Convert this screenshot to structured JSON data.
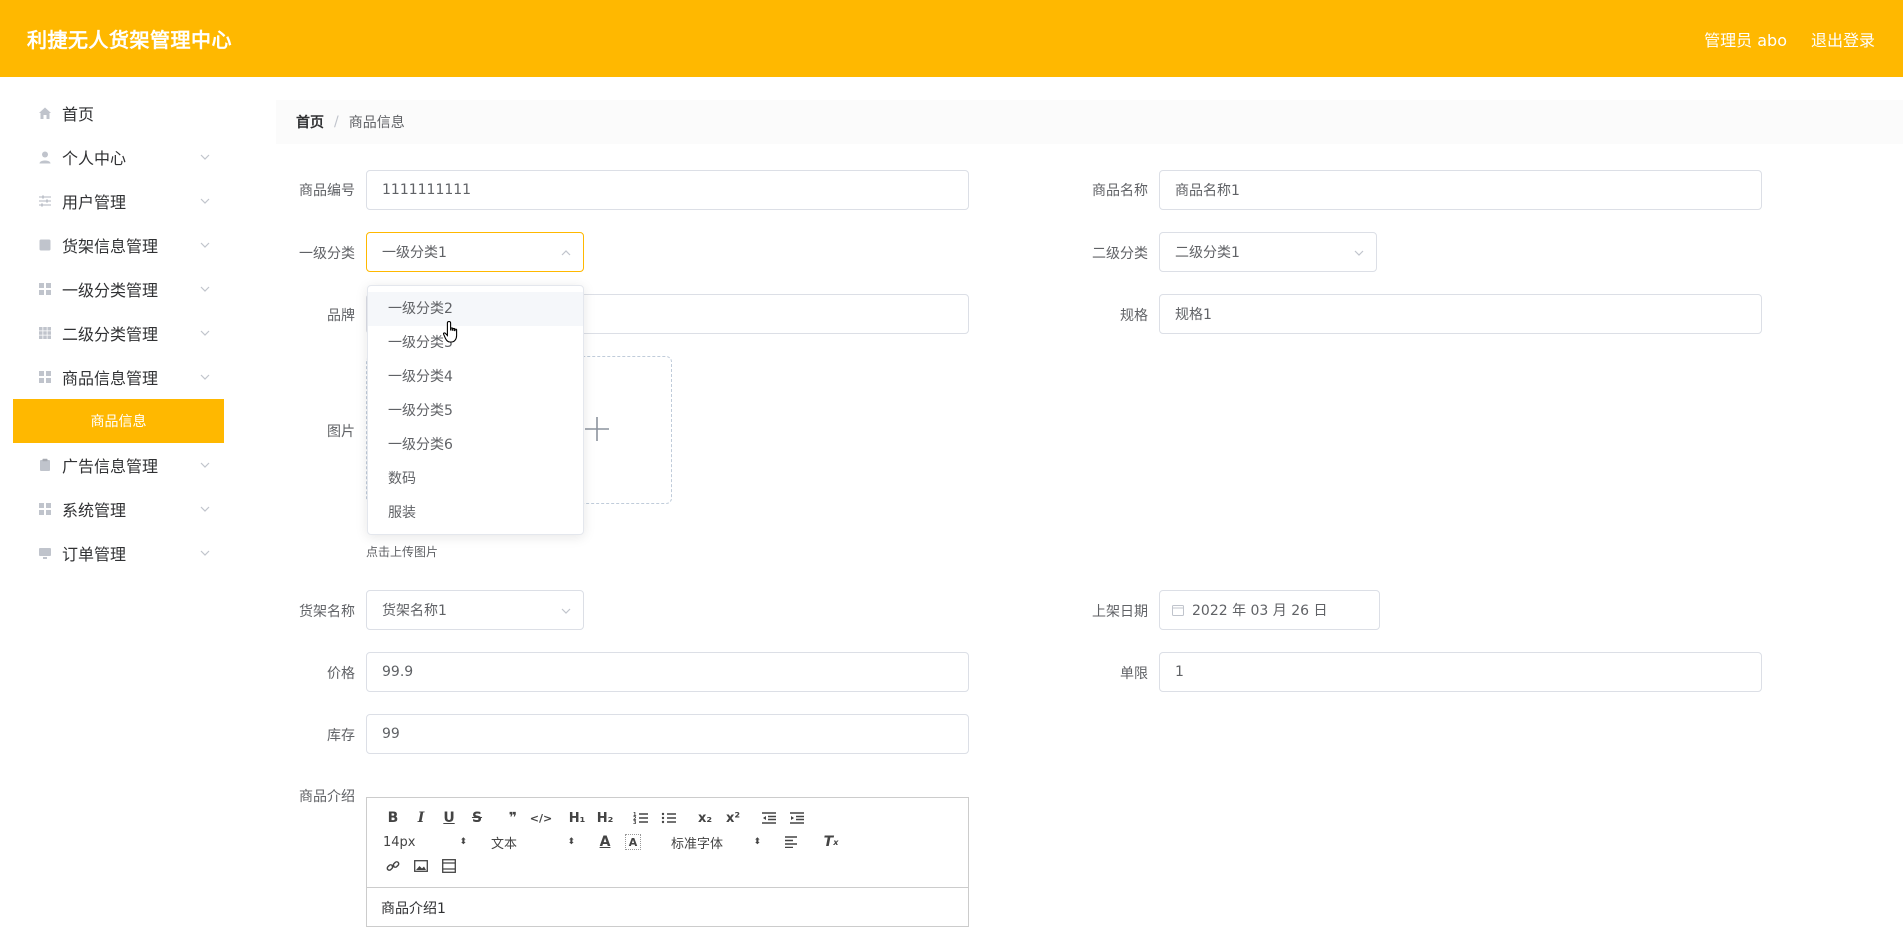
{
  "header": {
    "title": "利捷无人货架管理中心",
    "admin_label": "管理员 abo",
    "logout_label": "退出登录"
  },
  "sidebar": {
    "items": [
      {
        "label": "首页",
        "icon": "home-icon"
      },
      {
        "label": "个人中心",
        "icon": "user-icon"
      },
      {
        "label": "用户管理",
        "icon": "sliders-icon"
      },
      {
        "label": "货架信息管理",
        "icon": "square-icon"
      },
      {
        "label": "一级分类管理",
        "icon": "grid-icon"
      },
      {
        "label": "二级分类管理",
        "icon": "grid-icon"
      },
      {
        "label": "商品信息管理",
        "icon": "grid-icon"
      },
      {
        "label": "广告信息管理",
        "icon": "clipboard-icon"
      },
      {
        "label": "系统管理",
        "icon": "grid-icon"
      },
      {
        "label": "订单管理",
        "icon": "monitor-icon"
      }
    ],
    "active_sub": "商品信息"
  },
  "breadcrumb": {
    "home": "首页",
    "sep": "/",
    "current": "商品信息"
  },
  "form": {
    "code_label": "商品编号",
    "code_value": "1111111111",
    "name_label": "商品名称",
    "name_value": "商品名称1",
    "cat1_label": "一级分类",
    "cat1_value": "一级分类1",
    "cat2_label": "二级分类",
    "cat2_value": "二级分类1",
    "brand_label": "品牌",
    "brand_value": "",
    "spec_label": "规格",
    "spec_value": "规格1",
    "image_label": "图片",
    "upload_tip": "点击上传图片",
    "shelf_label": "货架名称",
    "shelf_value": "货架名称1",
    "date_label": "上架日期",
    "date_value": "2022 年 03 月 26 日",
    "price_label": "价格",
    "price_value": "99.9",
    "limit_label": "单限",
    "limit_value": "1",
    "stock_label": "库存",
    "stock_value": "99",
    "intro_label": "商品介绍",
    "intro_value": "商品介绍1"
  },
  "dropdown": {
    "options": [
      "一级分类2",
      "一级分类3",
      "一级分类4",
      "一级分类5",
      "一级分类6",
      "数码",
      "服装"
    ]
  },
  "editor": {
    "font_size": "14px",
    "text_style": "文本",
    "font_family": "标准字体"
  }
}
